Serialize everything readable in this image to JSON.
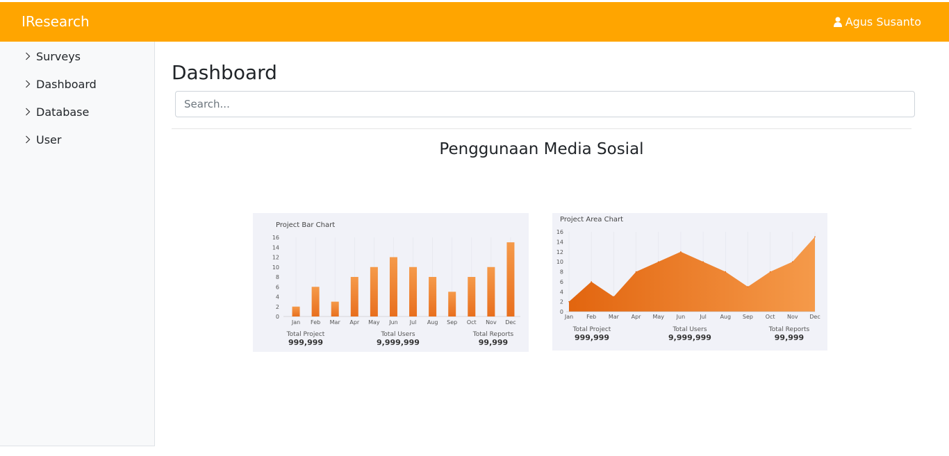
{
  "app": {
    "brand": "IResearch",
    "user_name": "Agus Susanto"
  },
  "sidebar": {
    "items": [
      {
        "label": "Surveys"
      },
      {
        "label": "Dashboard"
      },
      {
        "label": "Database"
      },
      {
        "label": "User"
      }
    ]
  },
  "main": {
    "title": "Dashboard",
    "search": {
      "placeholder": "Search...",
      "value": ""
    },
    "section_title": "Penggunaan Media Sosial"
  },
  "colors": {
    "header": "#ffa500",
    "bar": "#f08a3a",
    "area": "#ee7f30",
    "card_bg": "#f1f2f8"
  },
  "chart_data": [
    {
      "type": "bar",
      "title": "Project Bar Chart",
      "categories": [
        "Jan",
        "Feb",
        "Mar",
        "Apr",
        "May",
        "Jun",
        "Jul",
        "Aug",
        "Sep",
        "Oct",
        "Nov",
        "Dec"
      ],
      "values": [
        2,
        6,
        3,
        8,
        10,
        12,
        10,
        8,
        5,
        8,
        10,
        15
      ],
      "ylim": [
        0,
        16
      ],
      "yticks": [
        "0",
        "2",
        "4",
        "6",
        "8",
        "10",
        "12",
        "14",
        "16"
      ],
      "grid": true,
      "stats": [
        {
          "label": "Total Project",
          "value": "999,999"
        },
        {
          "label": "Total Users",
          "value": "9,999,999"
        },
        {
          "label": "Total Reports",
          "value": "99,999"
        }
      ]
    },
    {
      "type": "area",
      "title": "Project Area Chart",
      "categories": [
        "Jan",
        "Feb",
        "Mar",
        "Apr",
        "May",
        "Jun",
        "Jul",
        "Aug",
        "Sep",
        "Oct",
        "Nov",
        "Dec"
      ],
      "values": [
        2,
        6,
        3,
        8,
        10,
        12,
        10,
        8,
        5,
        8,
        10,
        15
      ],
      "ylim": [
        0,
        16
      ],
      "yticks": [
        "0",
        "2",
        "4",
        "6",
        "8",
        "10",
        "12",
        "14",
        "16"
      ],
      "grid": true,
      "stats": [
        {
          "label": "Total Project",
          "value": "999,999"
        },
        {
          "label": "Total Users",
          "value": "9,999,999"
        },
        {
          "label": "Total Reports",
          "value": "99,999"
        }
      ]
    }
  ]
}
